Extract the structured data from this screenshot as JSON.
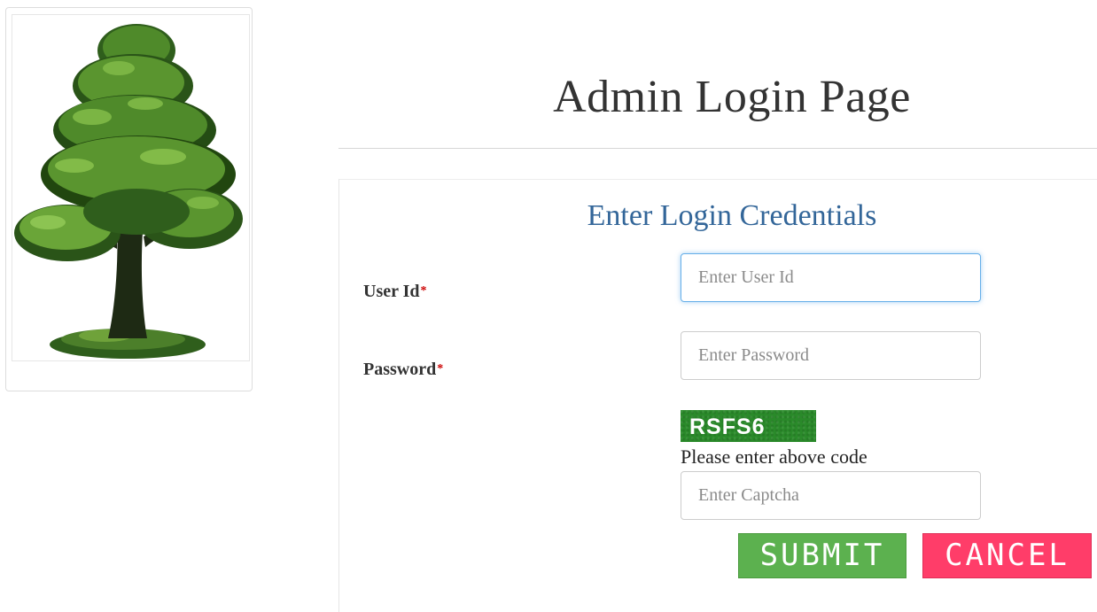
{
  "page": {
    "title": "Admin Login Page"
  },
  "logo": {
    "icon": "tree-logo"
  },
  "form": {
    "heading": "Enter Login Credentials",
    "user_id": {
      "label": "User Id",
      "required_mark": "*",
      "placeholder": "Enter User Id",
      "value": ""
    },
    "password": {
      "label": "Password",
      "required_mark": "*",
      "placeholder": "Enter Password",
      "value": ""
    },
    "captcha": {
      "code": "RSFS6",
      "hint": "Please enter above code",
      "placeholder": "Enter Captcha",
      "value": ""
    },
    "submit_label": "SUBMIT",
    "cancel_label": "CANCEL"
  },
  "colors": {
    "heading": "#336699",
    "required": "#cc0000",
    "submit": "#5cb14f",
    "cancel": "#ff3d69",
    "captcha_bg": "#2a8a2a",
    "focus_border": "#66afe9"
  }
}
